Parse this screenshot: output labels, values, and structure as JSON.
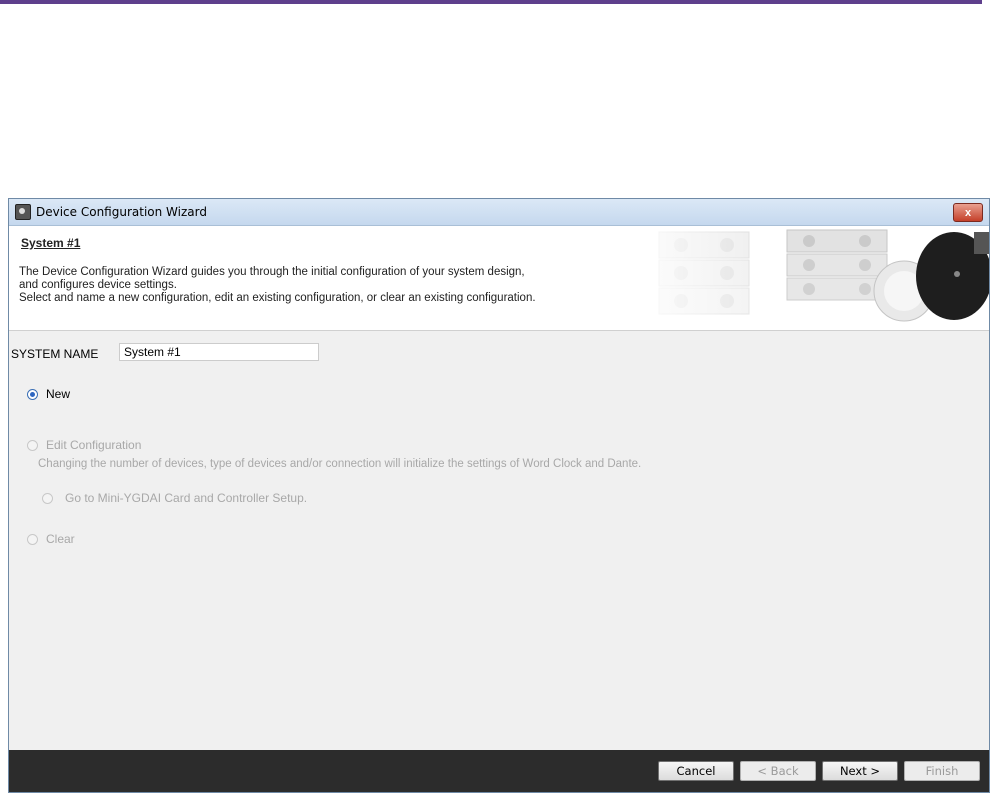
{
  "window": {
    "title": "Device Configuration Wizard",
    "close_label": "x"
  },
  "banner": {
    "heading": "System #1",
    "lines": [
      "The Device Configuration Wizard guides you through the initial configuration of your system design,",
      "and configures device settings.",
      "Select and name a new configuration, edit an existing configuration, or clear an existing configuration."
    ]
  },
  "system_name": {
    "label": "SYSTEM NAME",
    "value": "System #1"
  },
  "options": {
    "new": {
      "label": "New",
      "selected": true,
      "enabled": true
    },
    "edit": {
      "label": "Edit Configuration",
      "selected": false,
      "enabled": false,
      "note": "Changing the number of devices, type of devices and/or connection will initialize the settings of Word Clock and Dante."
    },
    "mini_ygdai": {
      "label": "Go to Mini-YGDAI Card and Controller Setup.",
      "selected": false,
      "enabled": false
    },
    "clear": {
      "label": "Clear",
      "selected": false,
      "enabled": false
    }
  },
  "footer": {
    "cancel": "Cancel",
    "back": "< Back",
    "next": "Next >",
    "finish": "Finish"
  },
  "colors": {
    "accent_bar": "#5e3f8c",
    "footer_bg": "#2c2c2c",
    "radio_selected": "#2d66c1"
  }
}
